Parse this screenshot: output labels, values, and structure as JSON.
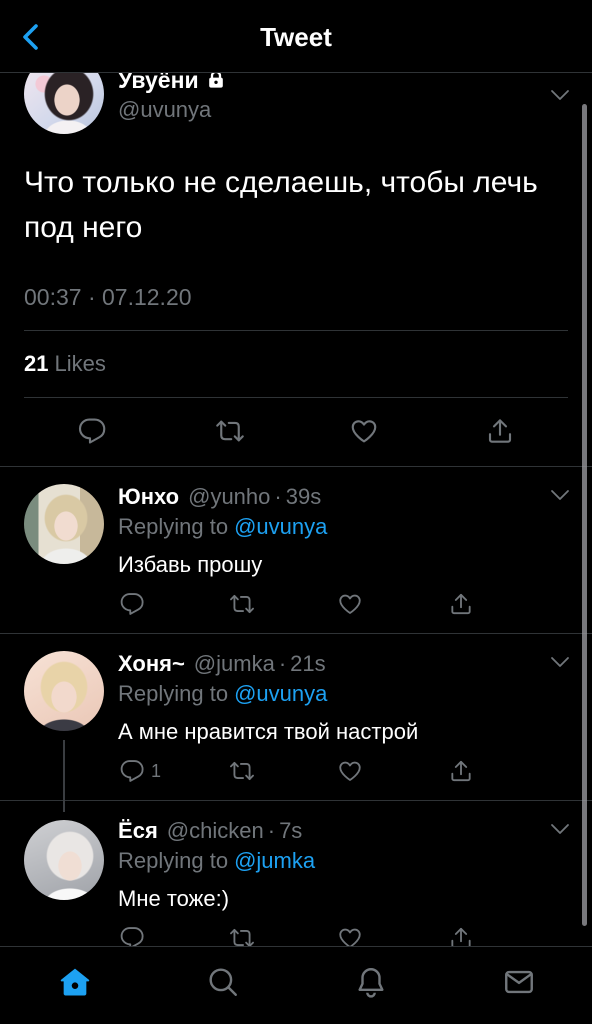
{
  "colors": {
    "background": "#000000",
    "accent": "#1da1f2",
    "primary_text": "#ffffff",
    "secondary_text": "#71767b",
    "divider": "#2f3336"
  },
  "header": {
    "back_icon": "chevron-left-icon",
    "title": "Tweet"
  },
  "main_tweet": {
    "name": "Увуёни",
    "protected_icon": "lock-icon",
    "handle": "@uvunya",
    "menu_icon": "chevron-down-icon",
    "text": "Что только не сделаешь, чтобы лечь под него",
    "timestamp": "00:37 · 07.12.20",
    "likes_count": "21",
    "likes_label": "Likes",
    "actions": [
      "reply-icon",
      "retweet-icon",
      "like-icon",
      "share-icon"
    ]
  },
  "replying_label": "Replying to",
  "separator": "·",
  "replies": [
    {
      "name": "Юнхо",
      "handle": "@yunho",
      "age": "39s",
      "replying_to": "@uvunya",
      "text": "Избавь прошу"
    },
    {
      "name": "Хоня~",
      "handle": "@jumka",
      "age": "21s",
      "replying_to": "@uvunya",
      "text": "А мне нравится твой настрой",
      "reply_count": "1"
    },
    {
      "name": "Ёся",
      "handle": "@chicken",
      "age": "7s",
      "replying_to": "@jumka",
      "text": "Мне тоже:)"
    }
  ],
  "tab_bar": [
    {
      "icon": "home-icon",
      "active": true
    },
    {
      "icon": "search-icon",
      "active": false
    },
    {
      "icon": "bell-icon",
      "active": false
    },
    {
      "icon": "mail-icon",
      "active": false
    }
  ]
}
